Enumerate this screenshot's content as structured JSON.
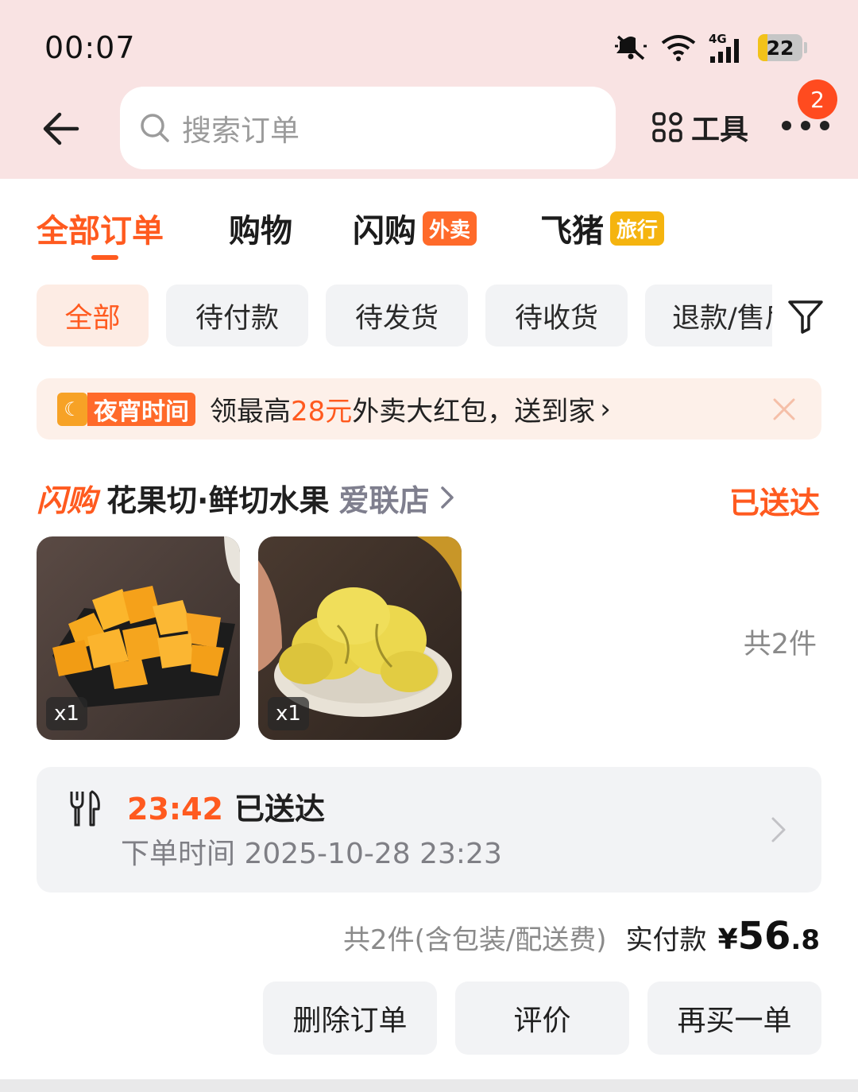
{
  "status_bar": {
    "time": "00:07",
    "network": "4G",
    "battery": "22",
    "battery_level": 0.22,
    "icons": [
      "mute-icon",
      "wifi-icon",
      "signal-icon",
      "battery-icon"
    ]
  },
  "header": {
    "back_icon": "back-arrow-icon",
    "search_placeholder": "搜索订单",
    "tools_label": "工具",
    "more_badge": "2"
  },
  "tabs": [
    {
      "label": "全部订单",
      "active": true,
      "tag": ""
    },
    {
      "label": "购物",
      "active": false,
      "tag": ""
    },
    {
      "label": "闪购",
      "active": false,
      "tag": "外卖",
      "tag_color": "#ff6a2a"
    },
    {
      "label": "飞猪",
      "active": false,
      "tag": "旅行",
      "tag_color": "#f5b40f"
    }
  ],
  "filters": [
    {
      "label": "全部",
      "active": true
    },
    {
      "label": "待付款",
      "active": false
    },
    {
      "label": "待发货",
      "active": false
    },
    {
      "label": "待收货",
      "active": false
    },
    {
      "label": "退款/售后",
      "active": false
    }
  ],
  "banner": {
    "label": "夜宵时间",
    "text_before": "领最高",
    "highlight": "28元",
    "text_after": "外卖大红包，送到家",
    "arrow": "›"
  },
  "order": {
    "brand": "闪购",
    "store_name": "花果切·鲜切水果",
    "store_branch": "爱联店",
    "status": "已送达",
    "items": [
      {
        "name": "mango",
        "qty": "x1"
      },
      {
        "name": "durian",
        "qty": "x1"
      }
    ],
    "item_count": "共2件",
    "delivery_time": "23:42",
    "delivery_status": "已送达",
    "order_time": "下单时间 2025-10-28 23:23",
    "total_desc": "共2件(含包装/配送费)",
    "paid_label": "实付款",
    "paid_currency": "¥",
    "paid_int": "56",
    "paid_dec": ".8"
  },
  "actions": {
    "delete": "删除订单",
    "review": "评价",
    "rebuy": "再买一单"
  },
  "colors": {
    "accent": "#ff5a1f",
    "header_bg": "#f9e3e3",
    "chip_bg": "#f2f3f5"
  }
}
